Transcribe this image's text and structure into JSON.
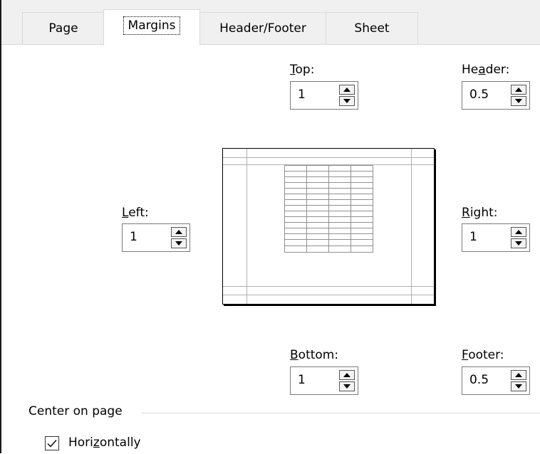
{
  "tabs": [
    {
      "label": "Page"
    },
    {
      "label": "Margins"
    },
    {
      "label": "Header/Footer"
    },
    {
      "label": "Sheet"
    }
  ],
  "active_tab": "Margins",
  "fields": {
    "top": {
      "label_pre": "",
      "mnemonic": "T",
      "label_post": "op:",
      "value": "1"
    },
    "header": {
      "label_pre": "He",
      "mnemonic": "a",
      "label_post": "der:",
      "value": "0.5"
    },
    "left": {
      "label_pre": "",
      "mnemonic": "L",
      "label_post": "eft:",
      "value": "1"
    },
    "right": {
      "label_pre": "",
      "mnemonic": "R",
      "label_post": "ight:",
      "value": "1"
    },
    "bottom": {
      "label_pre": "",
      "mnemonic": "B",
      "label_post": "ottom:",
      "value": "1"
    },
    "footer": {
      "label_pre": "",
      "mnemonic": "F",
      "label_post": "ooter:",
      "value": "0.5"
    }
  },
  "center_on_page": {
    "label": "Center on page",
    "horizontally": {
      "label_pre": "Hori",
      "mnemonic": "z",
      "label_post": "ontally",
      "checked": true
    }
  }
}
